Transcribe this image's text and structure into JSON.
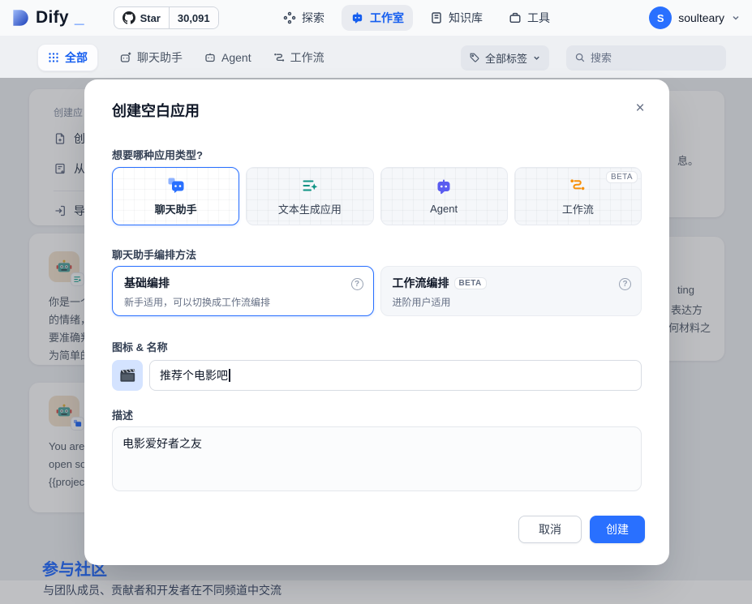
{
  "navbar": {
    "logo_text": "Dify",
    "logo_cursor": "_",
    "github": {
      "star_label": "Star",
      "star_count": "30,091"
    },
    "items": [
      {
        "label": "探索"
      },
      {
        "label": "工作室"
      },
      {
        "label": "知识库"
      },
      {
        "label": "工具"
      }
    ],
    "user": {
      "initial": "S",
      "name": "soulteary"
    }
  },
  "tabbar": {
    "tabs": [
      {
        "label": "全部"
      },
      {
        "label": "聊天助手"
      },
      {
        "label": "Agent"
      },
      {
        "label": "工作流"
      }
    ],
    "tag_filter_label": "全部标签",
    "search_placeholder": "搜索"
  },
  "background": {
    "create_menu": {
      "header": "创建应",
      "items": [
        "创",
        "从",
        "导"
      ]
    },
    "card_a": {
      "lines": [
        "你是一个",
        "的情绪，",
        "要准确判",
        "为简单的"
      ]
    },
    "card_b": {
      "lines": [
        "You are a",
        "open sou",
        "{{project}"
      ]
    },
    "right_fragments": [
      "息。",
      "ting",
      "表达方",
      "何材料之"
    ],
    "community": {
      "title": "参与社区",
      "subtitle": "与团队成员、贡献者和开发者在不同频道中交流"
    }
  },
  "modal": {
    "title": "创建空白应用",
    "close_glyph": "×",
    "help_glyph": "?",
    "type_label": "想要哪种应用类型?",
    "type_cards": [
      {
        "label": "聊天助手"
      },
      {
        "label": "文本生成应用"
      },
      {
        "label": "Agent"
      },
      {
        "label": "工作流",
        "badge": "BETA"
      }
    ],
    "orchestration_label": "聊天助手编排方法",
    "orchestration_options": [
      {
        "title": "基础编排",
        "subtitle": "新手适用，可以切换成工作流编排"
      },
      {
        "title": "工作流编排",
        "badge": "BETA",
        "subtitle": "进阶用户适用"
      }
    ],
    "name_label": "图标 & 名称",
    "app_icon": "clapperboard",
    "name_value": "推荐个电影吧",
    "desc_label": "描述",
    "desc_value": "电影爱好者之友",
    "cancel_label": "取消",
    "create_label": "创建"
  },
  "colors": {
    "primary": "#2970ff",
    "active_text": "#155eef",
    "beta_text": "#667085"
  }
}
